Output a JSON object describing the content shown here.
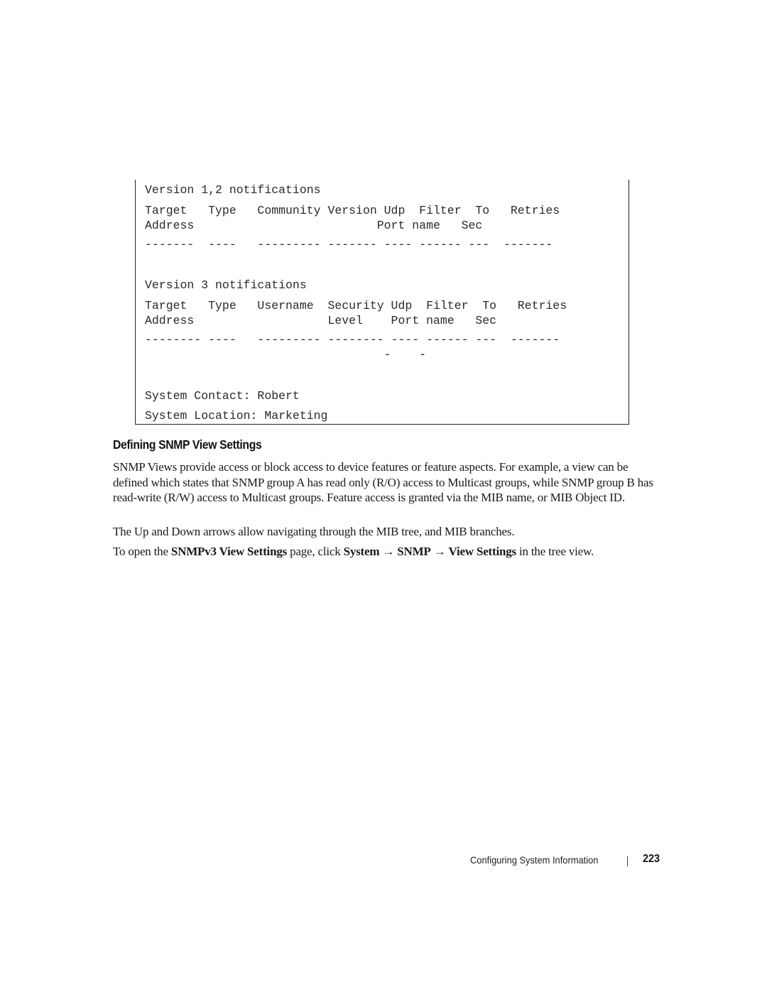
{
  "code_block": {
    "v12_title": "Version 1,2 notifications",
    "v12_header1": "Target   Type   Community Version Udp  Filter  To   Retries",
    "v12_header2": "Address                          Port name   Sec",
    "v12_dashes": "-------  ----   --------- ------- ---- ------ ---  -------",
    "v3_title": "Version 3 notifications",
    "v3_header1": "Target   Type   Username  Security Udp  Filter  To   Retries",
    "v3_header2": "Address                   Level    Port name   Sec",
    "v3_dashes": "-------- ----   --------- -------- ---- ------ ---  -------",
    "v3_dashes2": "                                  -    -",
    "system_contact": "System Contact: Robert",
    "system_location": "System Location: Marketing"
  },
  "section": {
    "heading": "Defining SNMP View Settings",
    "paragraph1": "SNMP Views provide access or block access to device features or feature aspects. For example, a view can be defined which states that SNMP group A has read only (R/O) access to Multicast groups, while SNMP group B has read-write (R/W) access to Multicast groups. Feature access is granted via the MIB name, or MIB Object ID.",
    "paragraph2": "The Up and Down arrows allow navigating through the MIB tree, and MIB branches.",
    "paragraph3": {
      "prefix": "To open the ",
      "page_name": "SNMPv3 View Settings",
      "middle": " page, click ",
      "path1": "System",
      "arrow1": " → ",
      "path2": "SNMP",
      "arrow2": " → ",
      "path3": "View Settings",
      "suffix": " in the tree view."
    }
  },
  "footer": {
    "chapter": "Configuring System Information",
    "page_number": "223"
  }
}
